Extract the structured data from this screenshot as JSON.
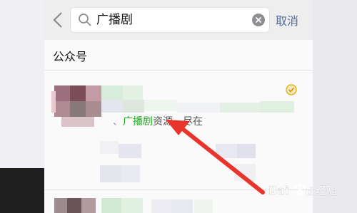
{
  "search": {
    "value": "广播剧",
    "cancel_label": "取消"
  },
  "section": {
    "title": "公众号"
  },
  "result": {
    "snippet_prefix": "、",
    "snippet_highlight": "广播剧",
    "snippet_suffix": "资源，尽在"
  },
  "watermark": {
    "text": "经验"
  },
  "colors": {
    "highlight": "#1aad19",
    "cancel": "#576b95",
    "annotation_arrow": "#e8342b"
  },
  "icons": [
    "chevron-left-icon",
    "search-icon",
    "clear-icon",
    "verified-badge-icon",
    "baidu-paw-icon"
  ]
}
